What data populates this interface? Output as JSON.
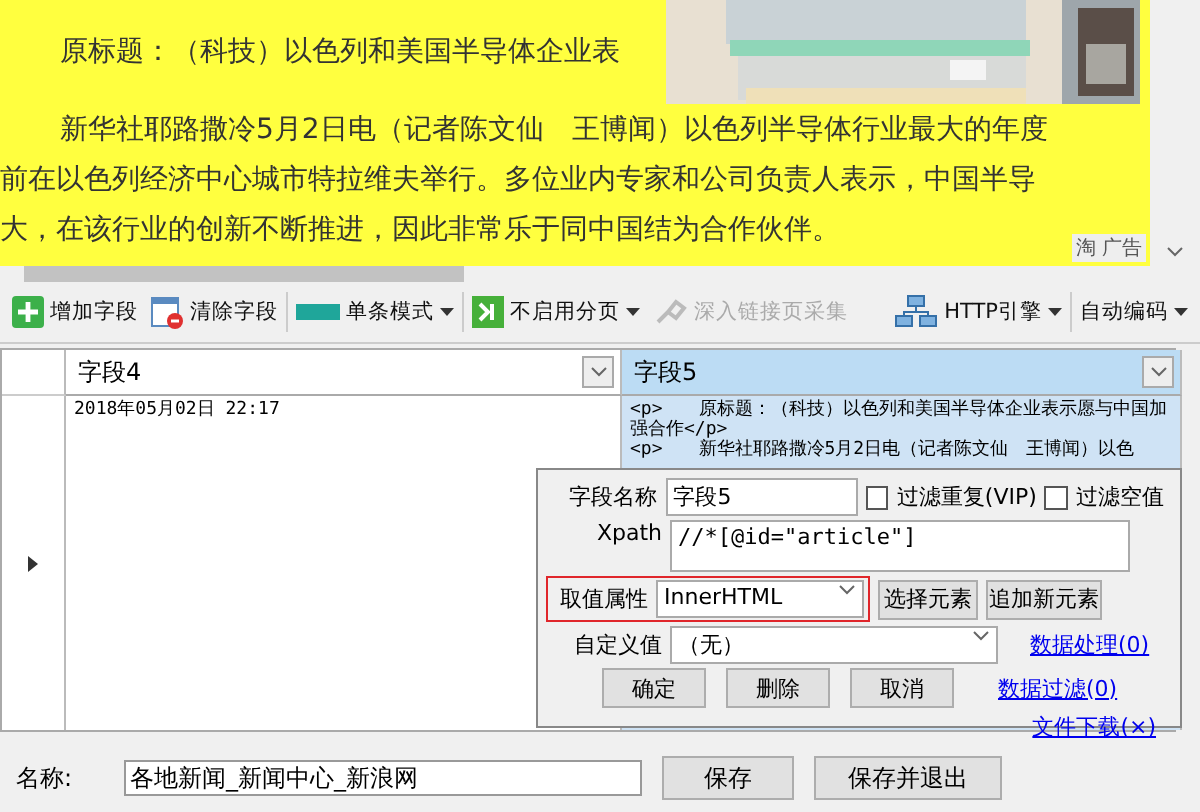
{
  "article": {
    "paragraphs": [
      "原标题：（科技）以色列和美国半导体企业表",
      "新华社耶路撒冷5月2日电（记者陈文仙　王博闻）以色列半导体行业最大的年度",
      "前在以色列经济中心城市特拉维夫举行。多位业内专家和公司负责人表示，中国半导",
      "大，在该行业的创新不断推进，因此非常乐于同中国结为合作伙伴。"
    ],
    "ad": {
      "kind": "picture",
      "label": "淘 广告"
    }
  },
  "toolbar": [
    {
      "kind": "add",
      "label": "增加字段",
      "dropdown": false,
      "disabled": false
    },
    {
      "kind": "clear",
      "label": "清除字段",
      "dropdown": false,
      "disabled": false
    },
    {
      "kind": "mode",
      "label": "单条模式",
      "dropdown": true,
      "disabled": false
    },
    {
      "kind": "paging",
      "label": "不启用分页",
      "dropdown": true,
      "disabled": false
    },
    {
      "kind": "deep",
      "label": "深入链接页采集",
      "dropdown": false,
      "disabled": true
    },
    {
      "kind": "http",
      "label": "HTTP引擎",
      "dropdown": true,
      "disabled": false
    },
    {
      "kind": "text",
      "label": "自动编码",
      "dropdown": true,
      "disabled": false
    }
  ],
  "table": {
    "columns": [
      {
        "label": "字段4",
        "selected": false
      },
      {
        "label": "字段5",
        "selected": true
      }
    ],
    "rows": [
      {
        "cells": [
          "2018年05月02日 22:17",
          "<p>　　原标题：（科技）以色列和美国半导体企业表示愿与中国加强合作</p>\n<p>　　新华社耶路撒冷5月2日电（记者陈文仙　王博闻）以色"
        ]
      }
    ]
  },
  "dialog": {
    "field_name_label": "字段名称",
    "field_name": "字段5",
    "filters": [
      {
        "label": "过滤重复(VIP)",
        "checked": false
      },
      {
        "label": "过滤空值",
        "checked": false
      }
    ],
    "xpath_label": "Xpath",
    "xpath": "//*[@id=\"article\"]",
    "attr_label": "取值属性",
    "attr_value": "InnerHTML",
    "attr_buttons": [
      "选择元素",
      "追加新元素"
    ],
    "custom_label": "自定义值",
    "custom_value": "（无）",
    "links": [
      "数据处理(0)",
      "数据过滤(0)",
      "文件下载(×)"
    ],
    "buttons": [
      "确定",
      "删除",
      "取消"
    ]
  },
  "footer": {
    "label": "名称:",
    "name": "各地新闻_新闻中心_新浪网",
    "buttons": [
      "保存",
      "保存并退出"
    ]
  }
}
